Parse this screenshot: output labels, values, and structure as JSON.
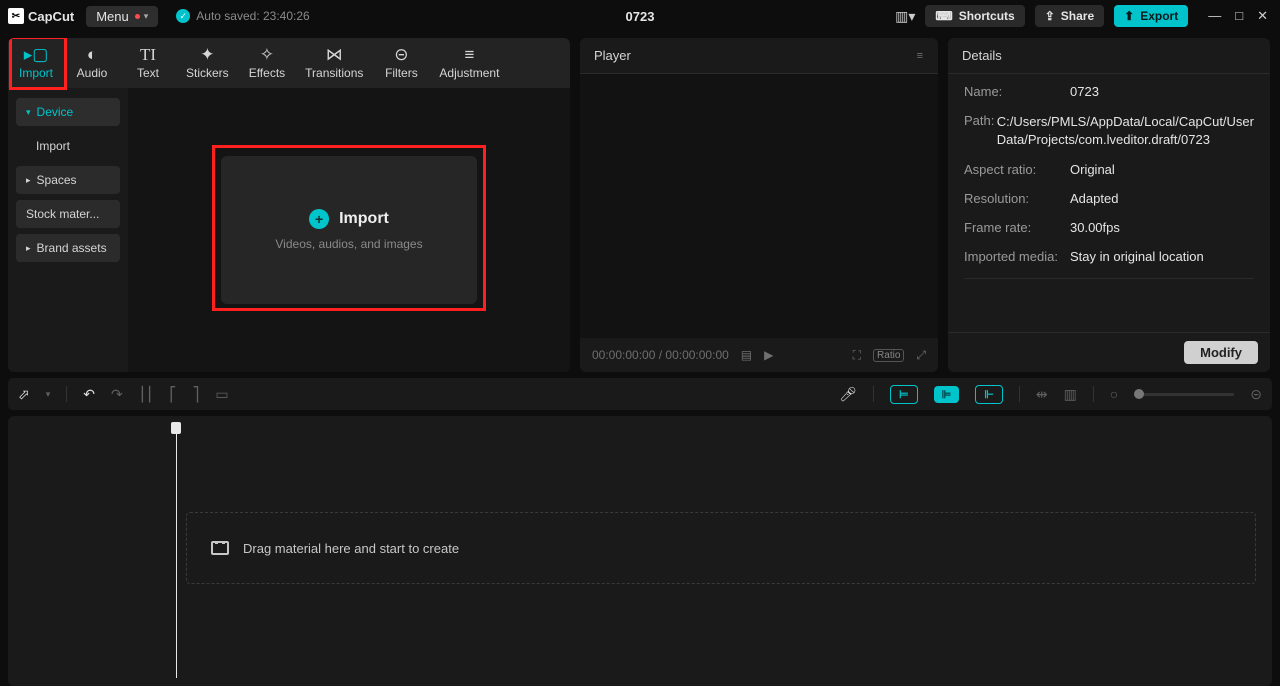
{
  "titlebar": {
    "app_name": "CapCut",
    "menu_label": "Menu",
    "autosave_label": "Auto saved: 23:40:26",
    "project_title": "0723",
    "shortcuts_label": "Shortcuts",
    "share_label": "Share",
    "export_label": "Export"
  },
  "tabs": {
    "import": "Import",
    "audio": "Audio",
    "text": "Text",
    "stickers": "Stickers",
    "effects": "Effects",
    "transitions": "Transitions",
    "filters": "Filters",
    "adjustment": "Adjustment"
  },
  "sidebar": {
    "device": "Device",
    "import": "Import",
    "spaces": "Spaces",
    "stock": "Stock mater...",
    "brand": "Brand assets"
  },
  "import_zone": {
    "title": "Import",
    "subtitle": "Videos, audios, and images"
  },
  "player": {
    "title": "Player",
    "time": "00:00:00:00 / 00:00:00:00",
    "ratio_label": "Ratio"
  },
  "details": {
    "title": "Details",
    "rows": {
      "name_k": "Name:",
      "name_v": "0723",
      "path_k": "Path:",
      "path_v": "C:/Users/PMLS/AppData/Local/CapCut/User Data/Projects/com.lveditor.draft/0723",
      "aspect_k": "Aspect ratio:",
      "aspect_v": "Original",
      "res_k": "Resolution:",
      "res_v": "Adapted",
      "fps_k": "Frame rate:",
      "fps_v": "30.00fps",
      "media_k": "Imported media:",
      "media_v": "Stay in original location"
    },
    "modify_label": "Modify"
  },
  "timeline": {
    "hint": "Drag material here and start to create"
  }
}
